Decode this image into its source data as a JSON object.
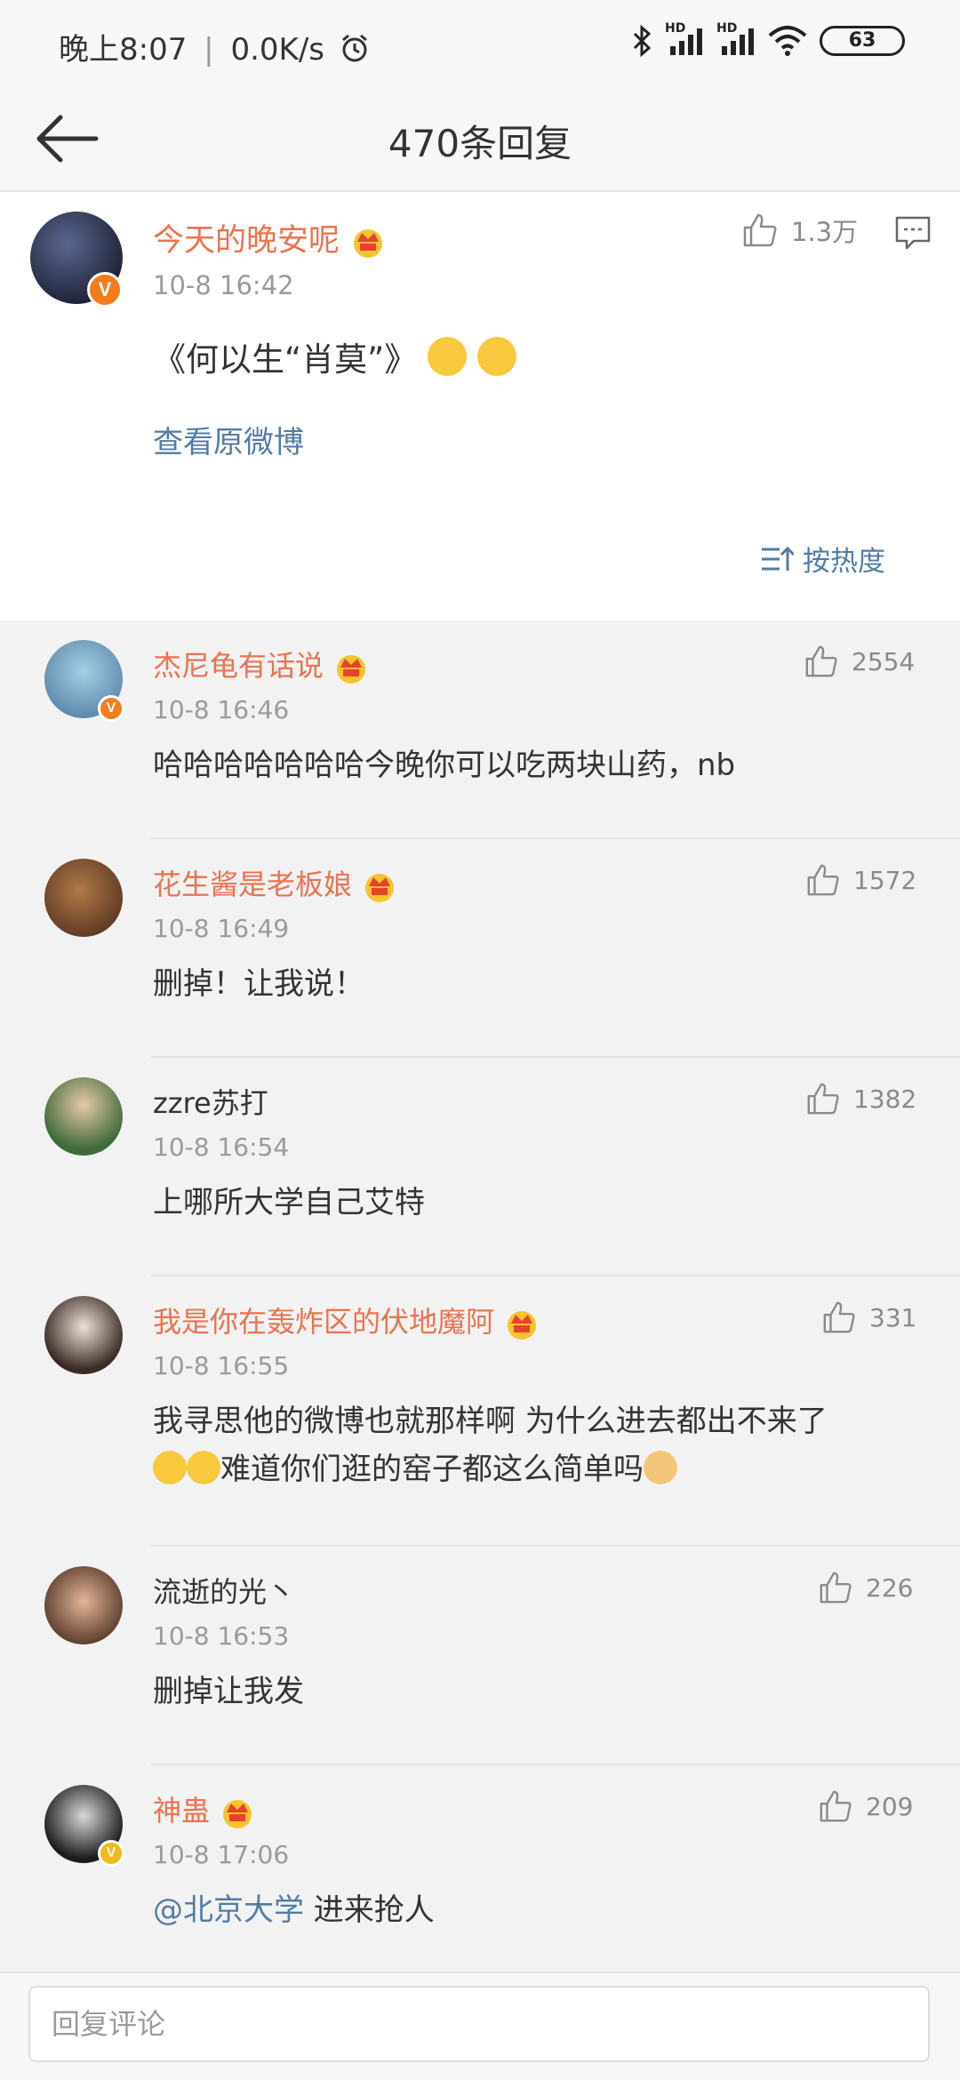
{
  "status": {
    "time": "晚上8:07",
    "speed": "0.0K/s",
    "battery": "63",
    "hd1": "HD",
    "hd2": "HD"
  },
  "nav": {
    "title": "470条回复"
  },
  "main_comment": {
    "author": "今天的晚安呢",
    "time": "10-8 16:42",
    "likes": "1.3万",
    "text": "《何以生“肖莫”》",
    "view_original": "查看原微博",
    "sort_label": "按热度"
  },
  "replies": [
    {
      "author": "杰尼龟有话说",
      "time": "10-8 16:46",
      "likes": "2554",
      "text": "哈哈哈哈哈哈哈今晚你可以吃两块山药，nb"
    },
    {
      "author": "花生酱是老板娘",
      "time": "10-8 16:49",
      "likes": "1572",
      "text": "删掉！让我说！"
    },
    {
      "author": "zzre苏打",
      "time": "10-8 16:54",
      "likes": "1382",
      "text": "上哪所大学自己艾特"
    },
    {
      "author": "我是你在轰炸区的伏地魔阿",
      "time": "10-8 16:55",
      "likes": "331",
      "text_line1": "我寻思他的微博也就那样啊 为什么进去都出不来了",
      "text_line2": "难道你们逛的窑子都这么简单吗"
    },
    {
      "author": "流逝的光丶",
      "time": "10-8 16:53",
      "likes": "226",
      "text": "删掉让我发"
    },
    {
      "author": "神蛊",
      "time": "10-8 17:06",
      "likes": "209",
      "mention": "@北京大学",
      "text": " 进来抢人"
    }
  ],
  "reply_input": {
    "placeholder": "回复评论"
  },
  "colors": {
    "vip_name": "#eb7350",
    "link": "#537ba7",
    "badge": "#f57c1c"
  },
  "icons": [
    "back-arrow-icon",
    "like-icon",
    "comment-icon",
    "sort-icon",
    "crown-icon",
    "verified-icon",
    "bluetooth-icon",
    "signal-icon",
    "wifi-icon",
    "alarm-icon"
  ]
}
